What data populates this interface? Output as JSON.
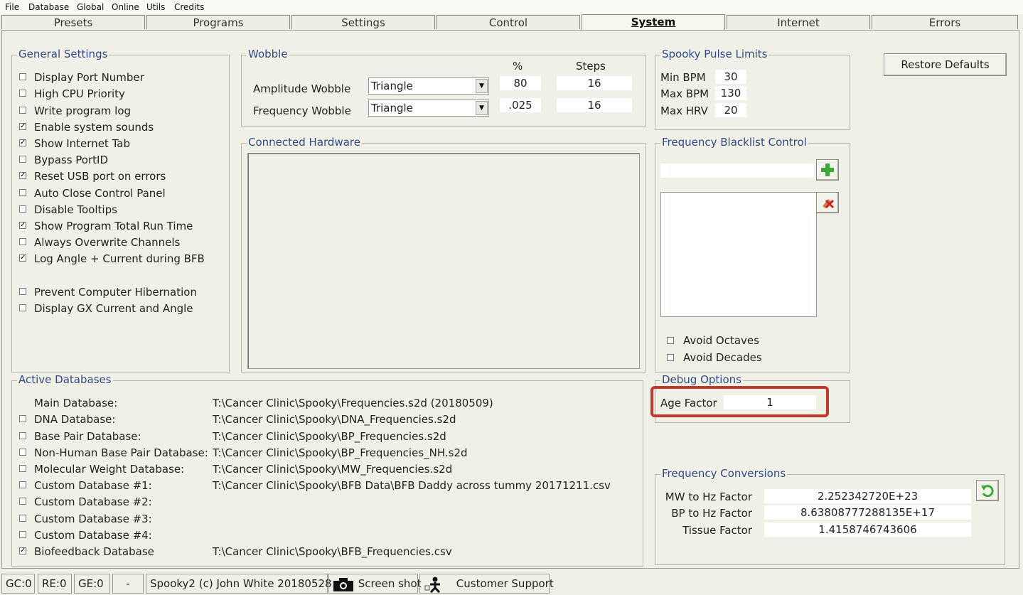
{
  "menu": [
    "File",
    "Database",
    "Global",
    "Online",
    "Utils",
    "Credits"
  ],
  "tabs": [
    "Presets",
    "Programs",
    "Settings",
    "Control",
    "System",
    "Internet",
    "Errors"
  ],
  "active_tab": "System",
  "general_settings": {
    "title": "General Settings",
    "items": [
      {
        "label": "Display Port Number",
        "checked": false
      },
      {
        "label": "High CPU Priority",
        "checked": false
      },
      {
        "label": "Write program log",
        "checked": false
      },
      {
        "label": "Enable system sounds",
        "checked": true
      },
      {
        "label": "Show Internet Tab",
        "checked": true
      },
      {
        "label": "Bypass PortID",
        "checked": false
      },
      {
        "label": "Reset USB port on errors",
        "checked": true
      },
      {
        "label": "Auto Close Control Panel",
        "checked": false
      },
      {
        "label": "Disable Tooltips",
        "checked": false
      },
      {
        "label": "Show Program Total Run Time",
        "checked": true
      },
      {
        "label": "Always Overwrite Channels",
        "checked": false
      },
      {
        "label": "Log Angle + Current during BFB",
        "checked": true
      },
      {
        "label": "Prevent Computer Hibernation",
        "checked": false
      },
      {
        "label": "Display GX Current and Angle",
        "checked": false
      }
    ]
  },
  "wobble": {
    "title": "Wobble",
    "col_percent": "%",
    "col_steps": "Steps",
    "amplitude": {
      "label": "Amplitude Wobble",
      "shape": "Triangle",
      "percent": "80",
      "steps": "16"
    },
    "frequency": {
      "label": "Frequency Wobble",
      "shape": "Triangle",
      "percent": ".025",
      "steps": "16"
    }
  },
  "connected_hardware": {
    "title": "Connected Hardware"
  },
  "pulse_limits": {
    "title": "Spooky Pulse Limits",
    "min_bpm_label": "Min BPM",
    "min_bpm": "30",
    "max_bpm_label": "Max BPM",
    "max_bpm": "130",
    "max_hrv_label": "Max HRV",
    "max_hrv": "20"
  },
  "restore_defaults": "Restore Defaults",
  "blacklist": {
    "title": "Frequency Blacklist Control",
    "input_value": "",
    "avoid_octaves": {
      "label": "Avoid Octaves",
      "checked": false
    },
    "avoid_decades": {
      "label": "Avoid Decades",
      "checked": false
    }
  },
  "debug": {
    "title": "Debug Options",
    "age_factor_label": "Age Factor",
    "age_factor": "1"
  },
  "active_databases": {
    "title": "Active Databases",
    "rows": [
      {
        "label": "Main Database:",
        "path": "T:\\Cancer Clinic\\Spooky\\Frequencies.s2d  (20180509)",
        "has_check": false,
        "checked": false
      },
      {
        "label": "DNA Database:",
        "path": "T:\\Cancer Clinic\\Spooky\\DNA_Frequencies.s2d",
        "has_check": true,
        "checked": false
      },
      {
        "label": "Base Pair Database:",
        "path": "T:\\Cancer Clinic\\Spooky\\BP_Frequencies.s2d",
        "has_check": true,
        "checked": false
      },
      {
        "label": "Non-Human Base Pair Database:",
        "path": "T:\\Cancer Clinic\\Spooky\\BP_Frequencies_NH.s2d",
        "has_check": true,
        "checked": false
      },
      {
        "label": "Molecular Weight Database:",
        "path": "T:\\Cancer Clinic\\Spooky\\MW_Frequencies.s2d",
        "has_check": true,
        "checked": false
      },
      {
        "label": "Custom Database #1:",
        "path": "T:\\Cancer Clinic\\Spooky\\BFB Data\\BFB Daddy across tummy 20171211.csv",
        "has_check": true,
        "checked": false
      },
      {
        "label": "Custom Database #2:",
        "path": "",
        "has_check": true,
        "checked": false
      },
      {
        "label": "Custom Database #3:",
        "path": "",
        "has_check": true,
        "checked": false
      },
      {
        "label": "Custom Database #4:",
        "path": "",
        "has_check": true,
        "checked": false
      },
      {
        "label": "Biofeedback Database",
        "path": "T:\\Cancer Clinic\\Spooky\\BFB_Frequencies.csv",
        "has_check": true,
        "checked": true
      }
    ]
  },
  "conversions": {
    "title": "Frequency Conversions",
    "mw_label": "MW to Hz Factor",
    "mw_value": "2.252342720E+23",
    "bp_label": "BP to Hz Factor",
    "bp_value": "8.63808777288135E+17",
    "tissue_label": "Tissue Factor",
    "tissue_value": "1.4158746743606"
  },
  "status": {
    "gc": "GC:0",
    "re": "RE:0",
    "ge": "GE:0",
    "dash": "-",
    "copyright": "Spooky2 (c) John White 20180528",
    "screenshot": "Screen shot",
    "support": "Customer Support"
  },
  "colors": {
    "highlight": "#c0392b",
    "group_title": "#2e4a88",
    "green_plus": "#3aa83a"
  }
}
